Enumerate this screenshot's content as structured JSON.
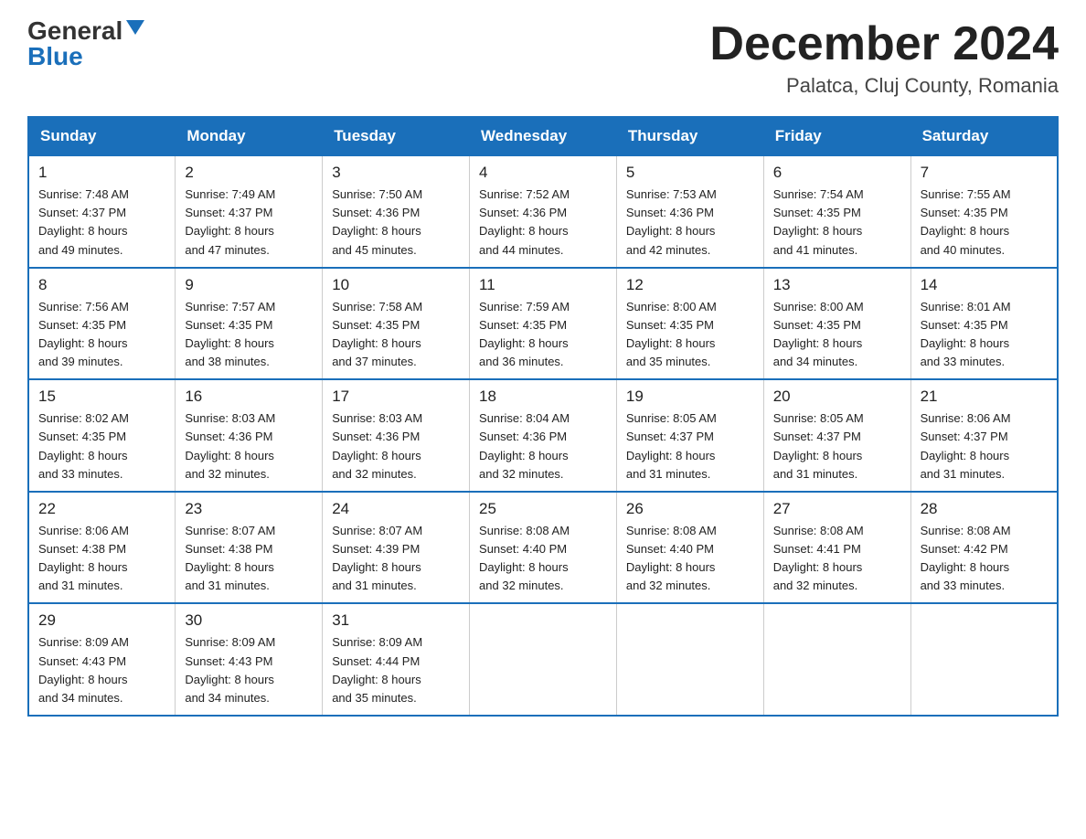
{
  "logo": {
    "general": "General",
    "blue": "Blue",
    "triangle": "▾"
  },
  "title": {
    "month_year": "December 2024",
    "location": "Palatca, Cluj County, Romania"
  },
  "headers": [
    "Sunday",
    "Monday",
    "Tuesday",
    "Wednesday",
    "Thursday",
    "Friday",
    "Saturday"
  ],
  "weeks": [
    [
      {
        "day": "1",
        "sunrise": "7:48 AM",
        "sunset": "4:37 PM",
        "daylight": "8 hours and 49 minutes."
      },
      {
        "day": "2",
        "sunrise": "7:49 AM",
        "sunset": "4:37 PM",
        "daylight": "8 hours and 47 minutes."
      },
      {
        "day": "3",
        "sunrise": "7:50 AM",
        "sunset": "4:36 PM",
        "daylight": "8 hours and 45 minutes."
      },
      {
        "day": "4",
        "sunrise": "7:52 AM",
        "sunset": "4:36 PM",
        "daylight": "8 hours and 44 minutes."
      },
      {
        "day": "5",
        "sunrise": "7:53 AM",
        "sunset": "4:36 PM",
        "daylight": "8 hours and 42 minutes."
      },
      {
        "day": "6",
        "sunrise": "7:54 AM",
        "sunset": "4:35 PM",
        "daylight": "8 hours and 41 minutes."
      },
      {
        "day": "7",
        "sunrise": "7:55 AM",
        "sunset": "4:35 PM",
        "daylight": "8 hours and 40 minutes."
      }
    ],
    [
      {
        "day": "8",
        "sunrise": "7:56 AM",
        "sunset": "4:35 PM",
        "daylight": "8 hours and 39 minutes."
      },
      {
        "day": "9",
        "sunrise": "7:57 AM",
        "sunset": "4:35 PM",
        "daylight": "8 hours and 38 minutes."
      },
      {
        "day": "10",
        "sunrise": "7:58 AM",
        "sunset": "4:35 PM",
        "daylight": "8 hours and 37 minutes."
      },
      {
        "day": "11",
        "sunrise": "7:59 AM",
        "sunset": "4:35 PM",
        "daylight": "8 hours and 36 minutes."
      },
      {
        "day": "12",
        "sunrise": "8:00 AM",
        "sunset": "4:35 PM",
        "daylight": "8 hours and 35 minutes."
      },
      {
        "day": "13",
        "sunrise": "8:00 AM",
        "sunset": "4:35 PM",
        "daylight": "8 hours and 34 minutes."
      },
      {
        "day": "14",
        "sunrise": "8:01 AM",
        "sunset": "4:35 PM",
        "daylight": "8 hours and 33 minutes."
      }
    ],
    [
      {
        "day": "15",
        "sunrise": "8:02 AM",
        "sunset": "4:35 PM",
        "daylight": "8 hours and 33 minutes."
      },
      {
        "day": "16",
        "sunrise": "8:03 AM",
        "sunset": "4:36 PM",
        "daylight": "8 hours and 32 minutes."
      },
      {
        "day": "17",
        "sunrise": "8:03 AM",
        "sunset": "4:36 PM",
        "daylight": "8 hours and 32 minutes."
      },
      {
        "day": "18",
        "sunrise": "8:04 AM",
        "sunset": "4:36 PM",
        "daylight": "8 hours and 32 minutes."
      },
      {
        "day": "19",
        "sunrise": "8:05 AM",
        "sunset": "4:37 PM",
        "daylight": "8 hours and 31 minutes."
      },
      {
        "day": "20",
        "sunrise": "8:05 AM",
        "sunset": "4:37 PM",
        "daylight": "8 hours and 31 minutes."
      },
      {
        "day": "21",
        "sunrise": "8:06 AM",
        "sunset": "4:37 PM",
        "daylight": "8 hours and 31 minutes."
      }
    ],
    [
      {
        "day": "22",
        "sunrise": "8:06 AM",
        "sunset": "4:38 PM",
        "daylight": "8 hours and 31 minutes."
      },
      {
        "day": "23",
        "sunrise": "8:07 AM",
        "sunset": "4:38 PM",
        "daylight": "8 hours and 31 minutes."
      },
      {
        "day": "24",
        "sunrise": "8:07 AM",
        "sunset": "4:39 PM",
        "daylight": "8 hours and 31 minutes."
      },
      {
        "day": "25",
        "sunrise": "8:08 AM",
        "sunset": "4:40 PM",
        "daylight": "8 hours and 32 minutes."
      },
      {
        "day": "26",
        "sunrise": "8:08 AM",
        "sunset": "4:40 PM",
        "daylight": "8 hours and 32 minutes."
      },
      {
        "day": "27",
        "sunrise": "8:08 AM",
        "sunset": "4:41 PM",
        "daylight": "8 hours and 32 minutes."
      },
      {
        "day": "28",
        "sunrise": "8:08 AM",
        "sunset": "4:42 PM",
        "daylight": "8 hours and 33 minutes."
      }
    ],
    [
      {
        "day": "29",
        "sunrise": "8:09 AM",
        "sunset": "4:43 PM",
        "daylight": "8 hours and 34 minutes."
      },
      {
        "day": "30",
        "sunrise": "8:09 AM",
        "sunset": "4:43 PM",
        "daylight": "8 hours and 34 minutes."
      },
      {
        "day": "31",
        "sunrise": "8:09 AM",
        "sunset": "4:44 PM",
        "daylight": "8 hours and 35 minutes."
      },
      null,
      null,
      null,
      null
    ]
  ]
}
